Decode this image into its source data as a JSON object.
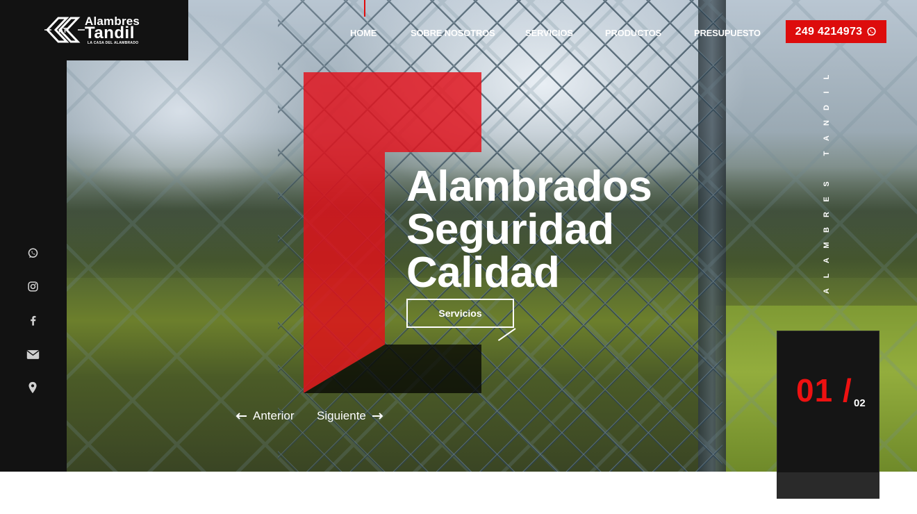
{
  "brand": {
    "line1": "Alambres",
    "line2": "Tandil",
    "tagline": "LA CASA DEL ALAMBRADO",
    "mark_letters": "AT"
  },
  "nav": {
    "items": [
      {
        "label": "HOME"
      },
      {
        "label": "SOBRE NOSOTROS"
      },
      {
        "label": "SERVICIOS"
      },
      {
        "label": "PRODUCTOS"
      },
      {
        "label": "PRESUPUESTO"
      }
    ],
    "phone": "249 4214973"
  },
  "social": [
    {
      "icon": "whatsapp-icon"
    },
    {
      "icon": "instagram-icon"
    },
    {
      "icon": "facebook-icon"
    },
    {
      "icon": "envelope-icon"
    },
    {
      "icon": "location-pin-icon"
    }
  ],
  "hero": {
    "headline": [
      "Alambrados",
      "Seguridad",
      "Calidad"
    ],
    "cta": "Servicios",
    "prev": "Anterior",
    "next": "Siguiente",
    "vertical_text": "ALAMBRES TANDIL",
    "slide_current": "01 /",
    "slide_total": "02"
  },
  "colors": {
    "accent": "#dd0c0c",
    "dark": "#121212"
  }
}
